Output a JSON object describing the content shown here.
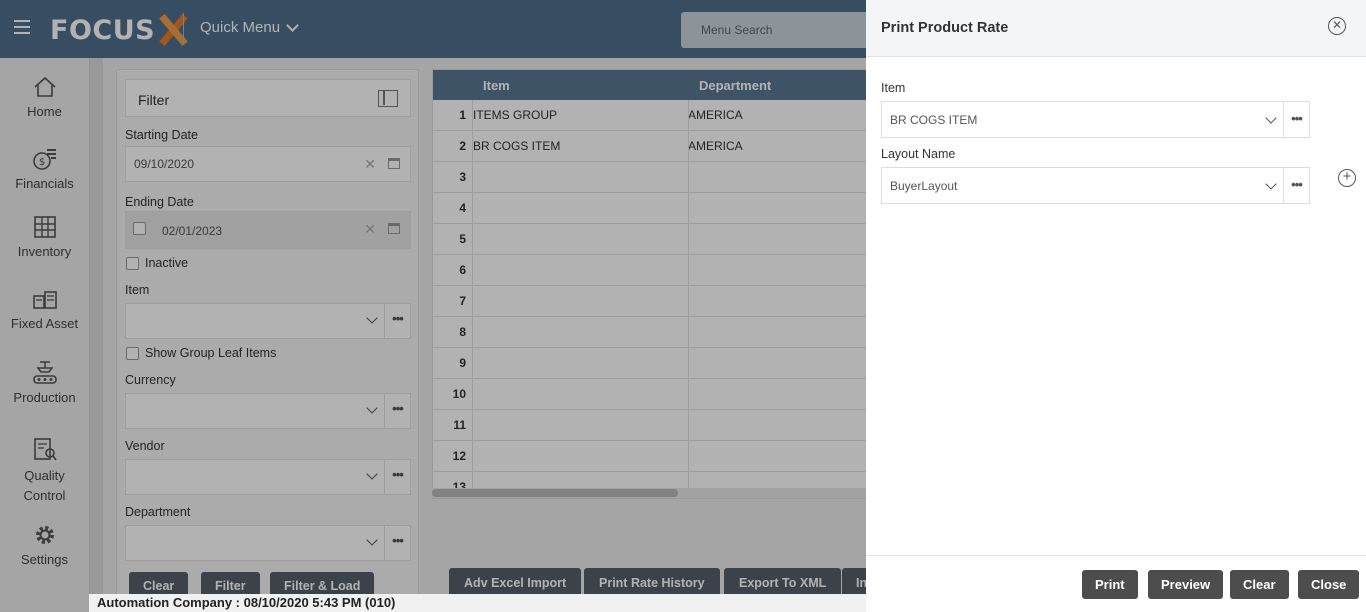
{
  "topbar": {
    "logo": "FOCUS",
    "quick_menu": "Quick Menu",
    "search_placeholder": "Menu Search"
  },
  "sidebar": {
    "items": [
      {
        "label": "Home",
        "icon": "home-icon"
      },
      {
        "label": "Financials",
        "icon": "financials-icon"
      },
      {
        "label": "Inventory",
        "icon": "inventory-icon"
      },
      {
        "label": "Fixed Asset",
        "icon": "fixed-asset-icon"
      },
      {
        "label": "Production",
        "icon": "production-icon"
      },
      {
        "label": "Quality Control",
        "icon": "quality-control-icon"
      },
      {
        "label": "Settings",
        "icon": "settings-icon"
      }
    ]
  },
  "filter": {
    "title": "Filter",
    "starting_date_label": "Starting Date",
    "starting_date": "09/10/2020",
    "ending_date_label": "Ending Date",
    "ending_date": "02/01/2023",
    "inactive_label": "Inactive",
    "item_label": "Item",
    "show_group_leaf_label": "Show Group Leaf Items",
    "currency_label": "Currency",
    "vendor_label": "Vendor",
    "department_label": "Department",
    "buttons": {
      "clear": "Clear",
      "filter": "Filter",
      "filter_load": "Filter & Load"
    }
  },
  "grid": {
    "columns": [
      "Item",
      "Department"
    ],
    "rows": [
      {
        "n": "1",
        "item": "ITEMS GROUP",
        "department": "AMERICA"
      },
      {
        "n": "2",
        "item": "BR COGS ITEM",
        "department": "AMERICA"
      },
      {
        "n": "3",
        "item": "",
        "department": ""
      },
      {
        "n": "4",
        "item": "",
        "department": ""
      },
      {
        "n": "5",
        "item": "",
        "department": ""
      },
      {
        "n": "6",
        "item": "",
        "department": ""
      },
      {
        "n": "7",
        "item": "",
        "department": ""
      },
      {
        "n": "8",
        "item": "",
        "department": ""
      },
      {
        "n": "9",
        "item": "",
        "department": ""
      },
      {
        "n": "10",
        "item": "",
        "department": ""
      },
      {
        "n": "11",
        "item": "",
        "department": ""
      },
      {
        "n": "12",
        "item": "",
        "department": ""
      },
      {
        "n": "13",
        "item": "",
        "department": ""
      }
    ],
    "buttons": {
      "adv_excel_import": "Adv Excel Import",
      "print_rate_history": "Print Rate History",
      "export_xml": "Export To XML",
      "more": "In"
    }
  },
  "status_bar": "Automation Company : 08/10/2020 5:43 PM (010)",
  "dialog": {
    "title": "Print Product Rate",
    "item_label": "Item",
    "item_value": "BR COGS ITEM",
    "layout_label": "Layout Name",
    "layout_value": "BuyerLayout",
    "buttons": {
      "print": "Print",
      "preview": "Preview",
      "clear": "Clear",
      "close": "Close"
    }
  }
}
